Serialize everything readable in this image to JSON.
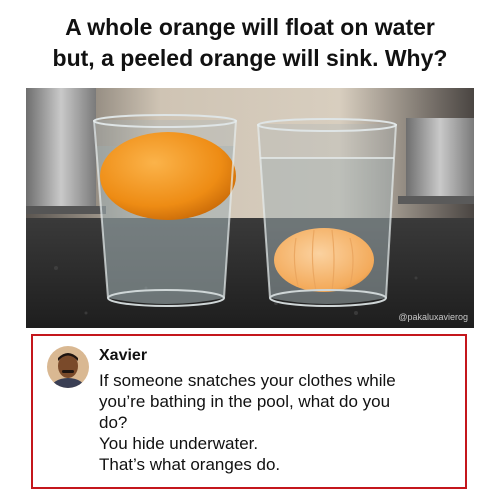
{
  "headline": {
    "line1": "A whole orange will float on water",
    "line2": "but, a peeled orange will sink. Why?"
  },
  "photo": {
    "watermark": "@pakaluxavierog"
  },
  "comment": {
    "author": "Xavier",
    "lines": [
      "If someone snatches your clothes while",
      "you’re bathing in the pool, what do you",
      "do?",
      "You hide underwater.",
      "That’s what oranges do."
    ]
  },
  "colors": {
    "frame_border": "#c4161c",
    "orange": "#f39a1e",
    "peeled_orange": "#f6b56a",
    "countertop": "#2b2b2b"
  }
}
